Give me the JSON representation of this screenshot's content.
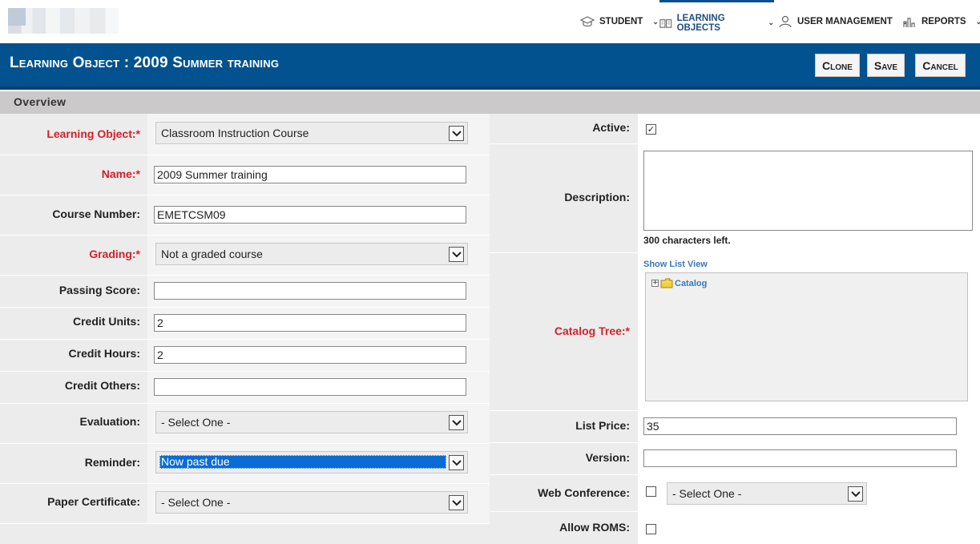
{
  "nav": {
    "items": [
      {
        "label": "STUDENT",
        "icon": "graduation-cap-icon"
      },
      {
        "label": "LEARNING OBJECTS",
        "icon": "book-icon",
        "active": true
      },
      {
        "label": "USER MANAGEMENT",
        "icon": "user-icon"
      },
      {
        "label": "REPORTS",
        "icon": "bar-chart-icon"
      }
    ]
  },
  "header": {
    "title": "Learning Object : 2009 Summer training",
    "buttons": {
      "clone": "Clone",
      "save": "Save",
      "cancel": "Cancel"
    },
    "accent_color": "#01528f"
  },
  "section": {
    "title": "Overview"
  },
  "left_form": {
    "learning_object": {
      "label": "Learning Object:*",
      "value": "Classroom Instruction Course"
    },
    "name": {
      "label": "Name:*",
      "value": "2009 Summer training"
    },
    "course_number": {
      "label": "Course Number:",
      "value": "EMETCSM09"
    },
    "grading": {
      "label": "Grading:*",
      "value": "Not a graded course"
    },
    "passing_score": {
      "label": "Passing Score:",
      "value": ""
    },
    "credit_units": {
      "label": "Credit Units:",
      "value": "2"
    },
    "credit_hours": {
      "label": "Credit Hours:",
      "value": "2"
    },
    "credit_others": {
      "label": "Credit Others:",
      "value": ""
    },
    "evaluation": {
      "label": "Evaluation:",
      "value": "- Select One -"
    },
    "reminder": {
      "label": "Reminder:",
      "value": "Now past due"
    },
    "paper_certificate": {
      "label": "Paper Certificate:",
      "value": "- Select One -"
    }
  },
  "right_form": {
    "active": {
      "label": "Active:",
      "checked": true
    },
    "description": {
      "label": "Description:",
      "value": "",
      "chars_left": "300 characters left."
    },
    "catalog_tree": {
      "label": "Catalog Tree:*",
      "show_list_view": "Show List View",
      "root": "Catalog"
    },
    "list_price": {
      "label": "List Price:",
      "value": "35"
    },
    "version": {
      "label": "Version:",
      "value": ""
    },
    "web_conference": {
      "label": "Web Conference:",
      "checked": false,
      "value": "- Select One -"
    },
    "allow_roms": {
      "label": "Allow ROMS:",
      "checked": false
    }
  }
}
